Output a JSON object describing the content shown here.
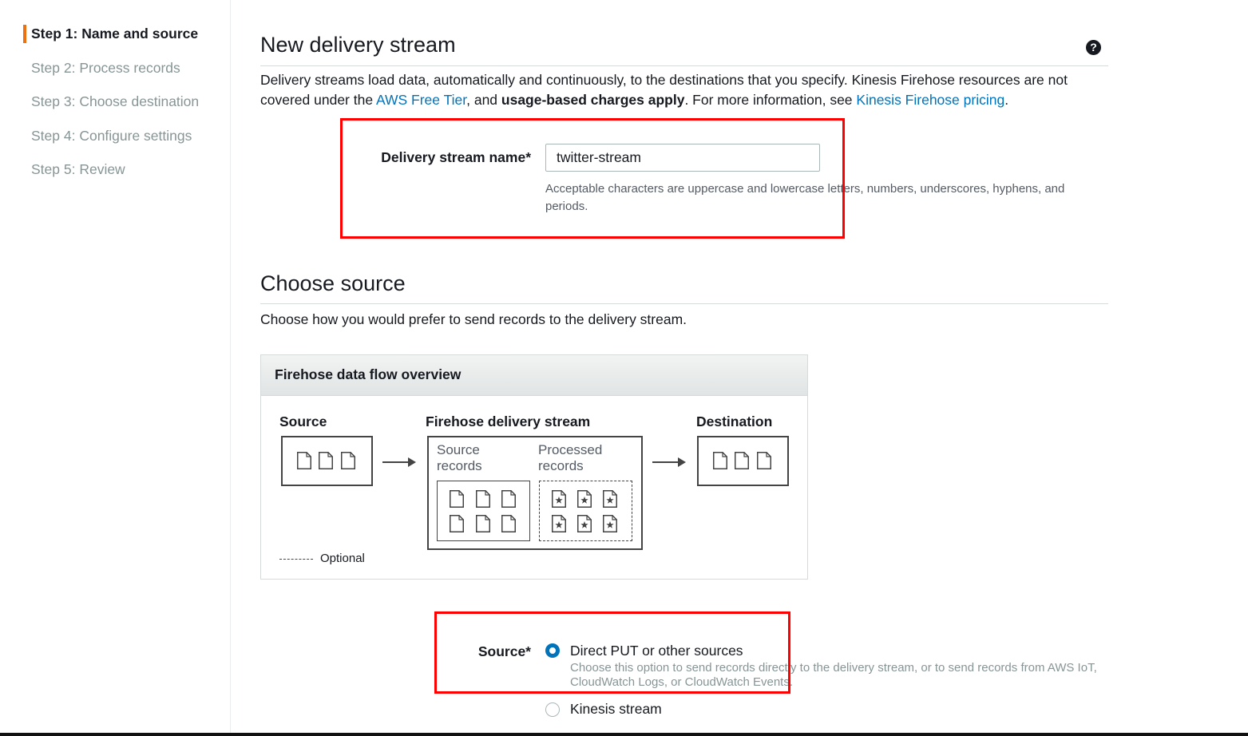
{
  "sidebar": {
    "steps": [
      {
        "label": "Step 1: Name and source"
      },
      {
        "label": "Step 2: Process records"
      },
      {
        "label": "Step 3: Choose destination"
      },
      {
        "label": "Step 4: Configure settings"
      },
      {
        "label": "Step 5: Review"
      }
    ]
  },
  "header": {
    "title": "New delivery stream",
    "help_glyph": "?",
    "intro": {
      "part1": "Delivery streams load data, automatically and continuously, to the destinations that you specify. Kinesis Firehose resources are not covered under the ",
      "free_tier_link": "AWS Free Tier",
      "part2": ", and ",
      "charges_bold": "usage-based charges apply",
      "part3": ". For more information, see ",
      "pricing_link": "Kinesis Firehose pricing",
      "part4": "."
    }
  },
  "name_field": {
    "label": "Delivery stream name*",
    "value": "twitter-stream",
    "hint": "Acceptable characters are uppercase and lowercase letters, numbers, underscores, hyphens, and periods."
  },
  "choose_source": {
    "title": "Choose source",
    "description": "Choose how you would prefer to send records to the delivery stream."
  },
  "flow_diagram": {
    "title": "Firehose data flow overview",
    "source_label": "Source",
    "stream_label": "Firehose delivery stream",
    "destination_label": "Destination",
    "source_records_line1": "Source",
    "source_records_line2": "records",
    "processed_records_line1": "Processed",
    "processed_records_line2": "records",
    "optional_label": "Optional"
  },
  "source_field": {
    "label": "Source*",
    "options": [
      {
        "label": "Direct PUT or other sources",
        "description": "Choose this option to send records directly to the delivery stream, or to send records from AWS IoT, CloudWatch Logs, or CloudWatch Events.",
        "selected": true
      },
      {
        "label": "Kinesis stream",
        "selected": false
      }
    ]
  },
  "colors": {
    "accent_orange": "#ec7211",
    "link_blue": "#0073bb",
    "highlight_red": "#ff0000"
  }
}
